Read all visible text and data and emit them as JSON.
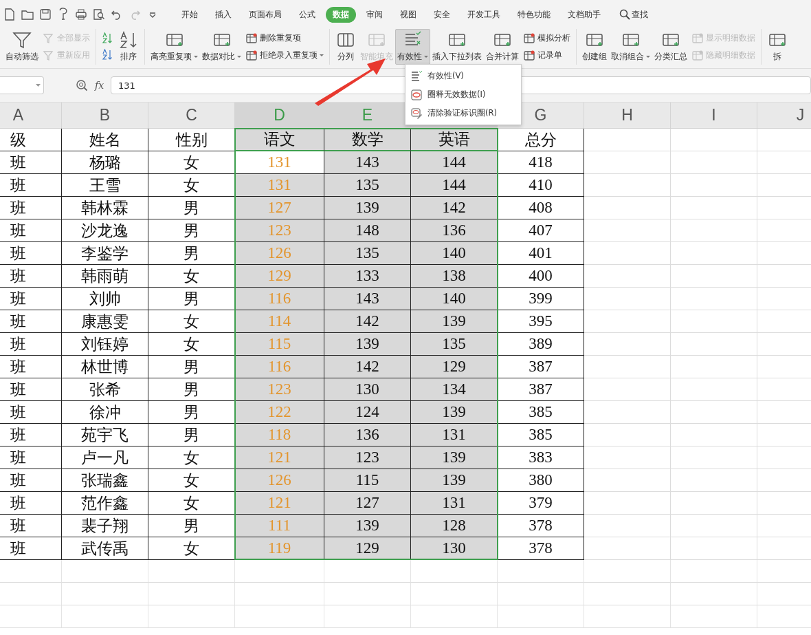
{
  "tabs": [
    {
      "label": "开始",
      "selected": false
    },
    {
      "label": "插入",
      "selected": false
    },
    {
      "label": "页面布局",
      "selected": false
    },
    {
      "label": "公式",
      "selected": false
    },
    {
      "label": "数据",
      "selected": true
    },
    {
      "label": "审阅",
      "selected": false
    },
    {
      "label": "视图",
      "selected": false
    },
    {
      "label": "安全",
      "selected": false
    },
    {
      "label": "开发工具",
      "selected": false
    },
    {
      "label": "特色功能",
      "selected": false
    },
    {
      "label": "文档助手",
      "selected": false
    }
  ],
  "search": {
    "label": "查找"
  },
  "ribbon": {
    "groups": [
      {
        "items": [
          {
            "kind": "large",
            "label": "自动筛选",
            "disabled": false,
            "dropdown": false,
            "selected": false
          },
          {
            "kind": "small",
            "label": "全部显示",
            "disabled": true,
            "dropdown": false,
            "selected": false
          },
          {
            "kind": "small",
            "label": "重新应用",
            "disabled": true,
            "dropdown": false,
            "selected": false
          }
        ]
      },
      {
        "items": [
          {
            "kind": "small",
            "disabled": false,
            "dropdown": false,
            "selected": false
          },
          {
            "kind": "small",
            "disabled": false,
            "dropdown": false,
            "selected": false
          },
          {
            "kind": "large",
            "label": "排序",
            "disabled": false,
            "dropdown": false,
            "selected": false
          }
        ]
      },
      {
        "items": [
          {
            "kind": "large",
            "label": "高亮重复项",
            "disabled": false,
            "dropdown": true,
            "selected": false
          },
          {
            "kind": "large",
            "label": "数据对比",
            "disabled": false,
            "dropdown": true,
            "selected": false
          },
          {
            "kind": "small",
            "label": "删除重复项",
            "disabled": false,
            "dropdown": false,
            "selected": false
          },
          {
            "kind": "small",
            "label": "拒绝录入重复项",
            "disabled": false,
            "dropdown": true,
            "selected": false
          }
        ]
      },
      {
        "items": [
          {
            "kind": "large",
            "label": "分列",
            "disabled": false,
            "dropdown": false,
            "selected": false
          },
          {
            "kind": "large",
            "label": "智能填充",
            "disabled": true,
            "dropdown": false,
            "selected": false
          },
          {
            "kind": "large",
            "label": "有效性",
            "disabled": false,
            "dropdown": true,
            "selected": true
          },
          {
            "kind": "large",
            "label": "插入下拉列表",
            "disabled": false,
            "dropdown": false,
            "selected": false
          },
          {
            "kind": "large",
            "label": "合并计算",
            "disabled": false,
            "dropdown": false,
            "selected": false
          },
          {
            "kind": "small",
            "label": "模拟分析",
            "disabled": false,
            "dropdown": false,
            "selected": false
          },
          {
            "kind": "small",
            "label": "记录单",
            "disabled": false,
            "dropdown": false,
            "selected": false
          }
        ]
      },
      {
        "items": [
          {
            "kind": "large",
            "label": "创建组",
            "disabled": false,
            "dropdown": false,
            "selected": false
          },
          {
            "kind": "large",
            "label": "取消组合",
            "disabled": false,
            "dropdown": true,
            "selected": false
          },
          {
            "kind": "large",
            "label": "分类汇总",
            "disabled": false,
            "dropdown": false,
            "selected": false
          },
          {
            "kind": "small",
            "label": "显示明细数据",
            "disabled": true,
            "dropdown": false,
            "selected": false
          },
          {
            "kind": "small",
            "label": "隐藏明细数据",
            "disabled": true,
            "dropdown": false,
            "selected": false
          }
        ]
      },
      {
        "items": [
          {
            "kind": "large",
            "label": "拆",
            "disabled": false,
            "dropdown": false,
            "selected": false
          }
        ]
      }
    ]
  },
  "formula_bar": {
    "label": "fx",
    "value": "131"
  },
  "menu": {
    "items": [
      {
        "label": "有效性(V)"
      },
      {
        "label": "圈释无效数据(I)"
      },
      {
        "label": "清除验证标识圈(R)"
      }
    ]
  },
  "columns": [
    {
      "label": "A",
      "selected": false,
      "orange_values": false
    },
    {
      "label": "B",
      "selected": false,
      "orange_values": false
    },
    {
      "label": "C",
      "selected": false,
      "orange_values": false
    },
    {
      "label": "D",
      "selected": true,
      "orange_values": true
    },
    {
      "label": "E",
      "selected": true,
      "orange_values": false
    },
    {
      "selected": true,
      "orange_values": false
    },
    {
      "label": "G",
      "selected": false,
      "orange_values": false
    },
    {
      "label": "H",
      "selected": false
    },
    {
      "label": "I",
      "selected": false
    },
    {
      "label": "J",
      "selected": false
    }
  ],
  "header_row": [
    "级",
    "姓名",
    "性别",
    "语文",
    "数学",
    "英语",
    "总分"
  ],
  "rows": [
    {
      "cells": [
        "班",
        "杨璐",
        "女",
        "131",
        "143",
        "144",
        "418"
      ],
      "active": true
    },
    {
      "cells": [
        "班",
        "王雪",
        "女",
        "131",
        "135",
        "144",
        "410"
      ],
      "active": false
    },
    {
      "cells": [
        "班",
        "韩林霖",
        "男",
        "127",
        "139",
        "142",
        "408"
      ],
      "active": false
    },
    {
      "cells": [
        "班",
        "沙龙逸",
        "男",
        "123",
        "148",
        "136",
        "407"
      ],
      "active": false
    },
    {
      "cells": [
        "班",
        "李鉴学",
        "男",
        "126",
        "135",
        "140",
        "401"
      ],
      "active": false
    },
    {
      "cells": [
        "班",
        "韩雨萌",
        "女",
        "129",
        "133",
        "138",
        "400"
      ],
      "active": false
    },
    {
      "cells": [
        "班",
        "刘帅",
        "男",
        "116",
        "143",
        "140",
        "399"
      ],
      "active": false
    },
    {
      "cells": [
        "班",
        "康惠雯",
        "女",
        "114",
        "142",
        "139",
        "395"
      ],
      "active": false
    },
    {
      "cells": [
        "班",
        "刘钰婷",
        "女",
        "115",
        "139",
        "135",
        "389"
      ],
      "active": false
    },
    {
      "cells": [
        "班",
        "林世博",
        "男",
        "116",
        "142",
        "129",
        "387"
      ],
      "active": false
    },
    {
      "cells": [
        "班",
        "张希",
        "男",
        "123",
        "130",
        "134",
        "387"
      ],
      "active": false
    },
    {
      "cells": [
        "班",
        "徐冲",
        "男",
        "122",
        "124",
        "139",
        "385"
      ],
      "active": false
    },
    {
      "cells": [
        "班",
        "苑宇飞",
        "男",
        "118",
        "136",
        "131",
        "385"
      ],
      "active": false
    },
    {
      "cells": [
        "班",
        "卢一凡",
        "女",
        "121",
        "123",
        "139",
        "383"
      ],
      "active": false
    },
    {
      "cells": [
        "班",
        "张瑞鑫",
        "女",
        "126",
        "115",
        "139",
        "380"
      ],
      "active": false
    },
    {
      "cells": [
        "班",
        "范作鑫",
        "女",
        "121",
        "127",
        "131",
        "379"
      ],
      "active": false
    },
    {
      "cells": [
        "班",
        "裴子翔",
        "男",
        "111",
        "139",
        "128",
        "378"
      ],
      "active": false
    },
    {
      "cells": [
        "班",
        "武传禹",
        "女",
        "119",
        "129",
        "130",
        "378"
      ],
      "active": false
    }
  ],
  "annotations": [
    {
      "kind": "arrow",
      "color": "#e8392f"
    }
  ]
}
